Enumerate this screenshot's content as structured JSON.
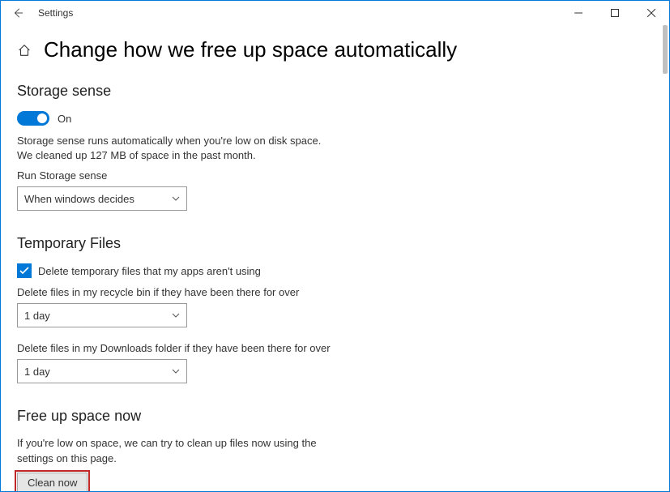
{
  "window": {
    "title": "Settings"
  },
  "page": {
    "heading": "Change how we free up space automatically"
  },
  "storage_sense": {
    "title": "Storage sense",
    "toggle_state": "On",
    "desc_line1": "Storage sense runs automatically when you're low on disk space.",
    "desc_line2": "We cleaned up 127 MB of space in the past month.",
    "run_label": "Run Storage sense",
    "run_value": "When windows decides"
  },
  "temp_files": {
    "title": "Temporary Files",
    "checkbox_label": "Delete temporary files that my apps aren't using",
    "recycle_label": "Delete files in my recycle bin if they have been there for over",
    "recycle_value": "1 day",
    "downloads_label": "Delete files in my Downloads folder if they have been there for over",
    "downloads_value": "1 day"
  },
  "free_up": {
    "title": "Free up space now",
    "desc": "If you're low on space, we can try to clean up files now using the settings on this page.",
    "button": "Clean now"
  }
}
